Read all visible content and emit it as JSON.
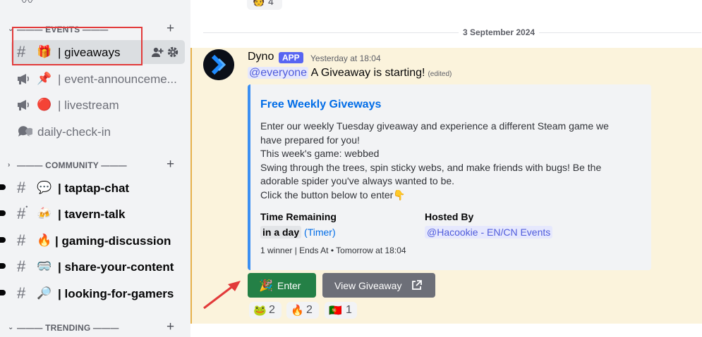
{
  "sidebar": {
    "categories": {
      "events": "——— EVENTS ———",
      "community": "——— COMMUNITY ———",
      "trending": "——— TRENDING ———"
    },
    "channels": [
      {
        "emoji": "🎁",
        "label": "| giveaways"
      },
      {
        "emoji": "📌",
        "label": "| event-announceme..."
      },
      {
        "emoji": "🔴",
        "label": "| livestream"
      },
      {
        "emoji": "",
        "label": "daily-check-in"
      },
      {
        "emoji": "💬",
        "label": "| taptap-chat"
      },
      {
        "emoji": "🍻",
        "label": "| tavern-talk"
      },
      {
        "emoji": "🔥",
        "label": "| gaming-discussion"
      },
      {
        "emoji": "🥽",
        "label": "| share-your-content"
      },
      {
        "emoji": "🔎",
        "label": "| looking-for-gamers"
      }
    ]
  },
  "chat": {
    "top_reaction_count": "4",
    "date_divider": "3 September 2024",
    "message": {
      "author": "Dyno",
      "badge": "APP",
      "timestamp": "Yesterday at 18:04",
      "mention": "@everyone",
      "text": " A Giveaway is starting!",
      "edited": "(edited)"
    },
    "embed": {
      "title": "Free Weekly Giveways",
      "desc_lines": [
        "Enter our weekly Tuesday giveaway and experience a different Steam game we",
        "have prepared for you!",
        "This week's game: webbed",
        "Swing through the trees, spin sticky webs, and make friends with bugs! Be the",
        "adorable spider you've always wanted to be.",
        "Click the button below to enter👇"
      ],
      "field1_name": "Time Remaining",
      "field1_value": "in a day",
      "field1_link": "(Timer)",
      "field2_name": "Hosted By",
      "field2_value": "@Hacookie - EN/CN Events",
      "footer": "1 winner | Ends At • Tomorrow at 18:04"
    },
    "buttons": {
      "enter_emoji": "🎉",
      "enter": "Enter",
      "view": "View Giveaway"
    },
    "reactions": [
      {
        "emoji": "🐸",
        "count": "2"
      },
      {
        "emoji": "🔥",
        "count": "2"
      },
      {
        "emoji": "🇵🇹",
        "count": "1"
      }
    ]
  },
  "colors": {
    "accent": "#5865f2",
    "embed_border": "#3b8ff2",
    "enter_button": "#248046",
    "highlight_bg": "#fbf3dc",
    "annotation": "#e23a3a"
  }
}
